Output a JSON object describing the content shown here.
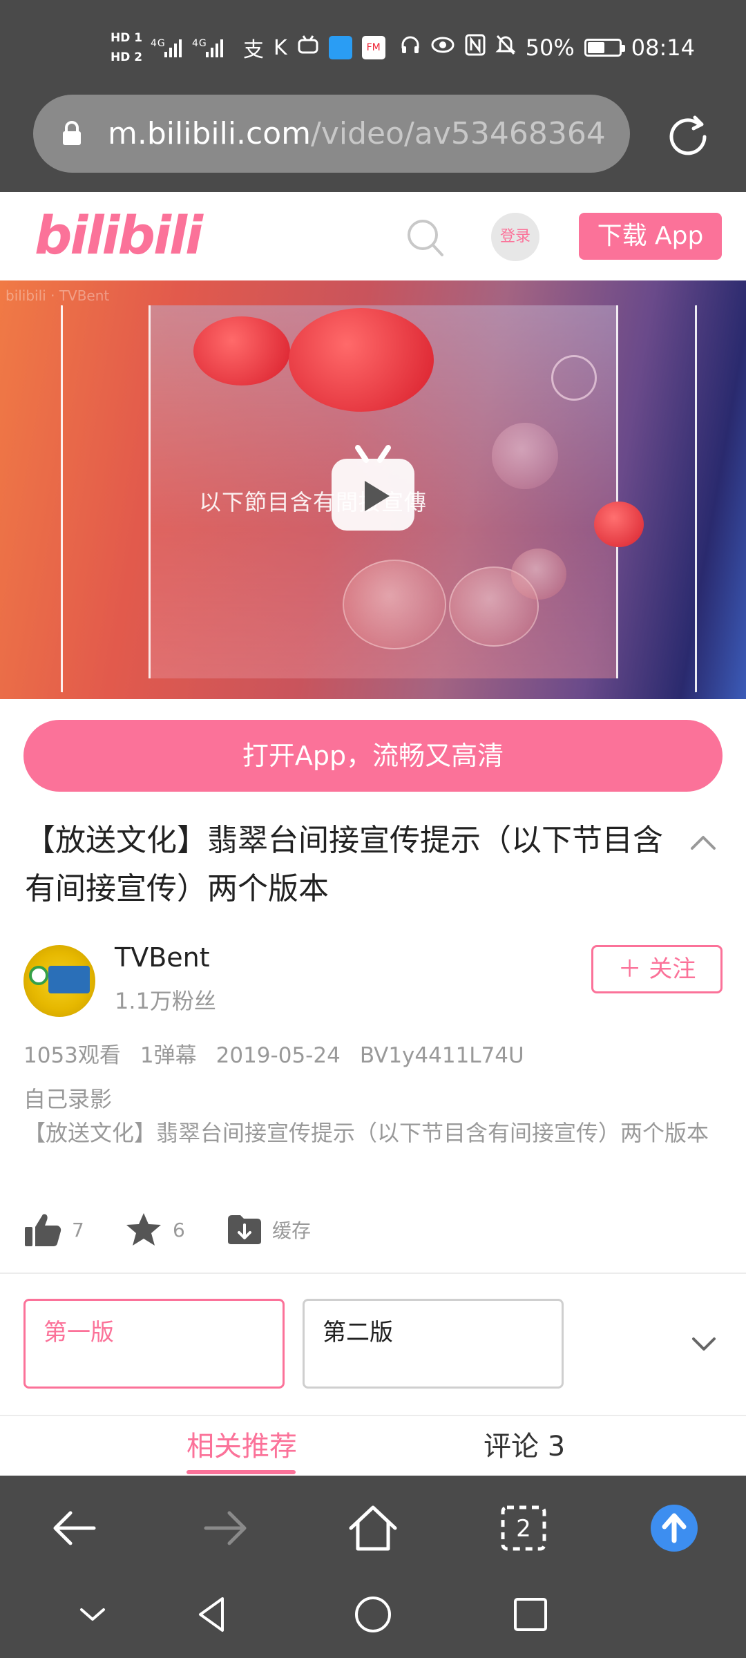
{
  "statusbar": {
    "hd1": "HD 1",
    "hd2": "HD 2",
    "signal": "4G ıl 4G ıl",
    "battery_text": "50%",
    "battery_level": 0.5,
    "time": "08:14",
    "app_icons": [
      "alipay-icon",
      "k-icon",
      "tv-icon",
      "book-icon",
      "fm-icon"
    ],
    "system_icons": [
      "headphone-icon",
      "eye-icon",
      "nfc-icon",
      "mute-icon"
    ]
  },
  "browser": {
    "url_host": "m.bilibili.com",
    "url_path": "/video/av53468364",
    "tab_count": "2"
  },
  "header": {
    "logo_text": "bilibili",
    "login_label": "登录",
    "download_label": "下载 App"
  },
  "video": {
    "watermark": "bilibili · TVBent",
    "caption": "以下節目含有間接宣傳"
  },
  "banner": {
    "open_app_label": "打开App，流畅又高清"
  },
  "detail": {
    "title": "【放送文化】翡翠台间接宣传提示（以下节目含有间接宣传）两个版本",
    "uploader_name": "TVBent",
    "fans": "1.1万粉丝",
    "follow_label": "＋ 关注",
    "views": "1053观看",
    "danmaku": "1弹幕",
    "date": "2019-05-24",
    "bvid": "BV1y4411L74U",
    "category": "自己录影",
    "description": "【放送文化】翡翠台间接宣传提示（以下节目含有间接宣传）两个版本"
  },
  "actions": {
    "likes": "7",
    "favorites": "6",
    "cache_label": "缓存"
  },
  "parts": [
    {
      "label": "第一版",
      "active": true
    },
    {
      "label": "第二版",
      "active": false
    }
  ],
  "tabs": {
    "related": "相关推荐",
    "comments": "评论 3"
  },
  "colors": {
    "accent": "#fb7299",
    "browser_chrome": "#4a4a4a",
    "upload_blue": "#3d8ef0"
  }
}
